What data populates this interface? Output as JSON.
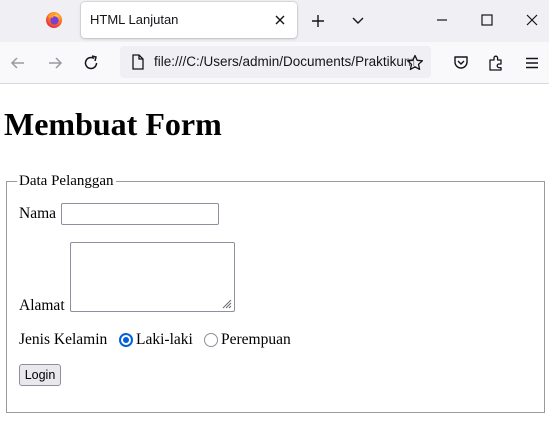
{
  "browser": {
    "tab_title": "HTML Lanjutan",
    "url": "file:///C:/Users/admin/Documents/Praktikum",
    "icons": {
      "logo": "firefox-logo-icon",
      "new_tab": "plus-icon",
      "tab_list": "chevron-down-icon",
      "back": "arrow-left-icon",
      "forward": "arrow-right-icon",
      "reload": "reload-icon",
      "page": "file-icon",
      "bookmark": "star-icon",
      "pocket": "pocket-icon",
      "extensions": "puzzle-icon",
      "menu": "hamburger-icon"
    }
  },
  "page": {
    "heading": "Membuat Form",
    "fieldset_legend": "Data Pelanggan",
    "name_label": "Nama",
    "name_value": "",
    "address_label": "Alamat",
    "address_value": "",
    "gender_label": "Jenis Kelamin",
    "gender_options": [
      {
        "label": "Laki-laki",
        "checked": true
      },
      {
        "label": "Perempuan",
        "checked": false
      }
    ],
    "submit_label": "Login"
  },
  "colors": {
    "accent": "#0060df",
    "tabbar_bg": "#f0f0f4",
    "navbar_bg": "#f9f9fb"
  }
}
